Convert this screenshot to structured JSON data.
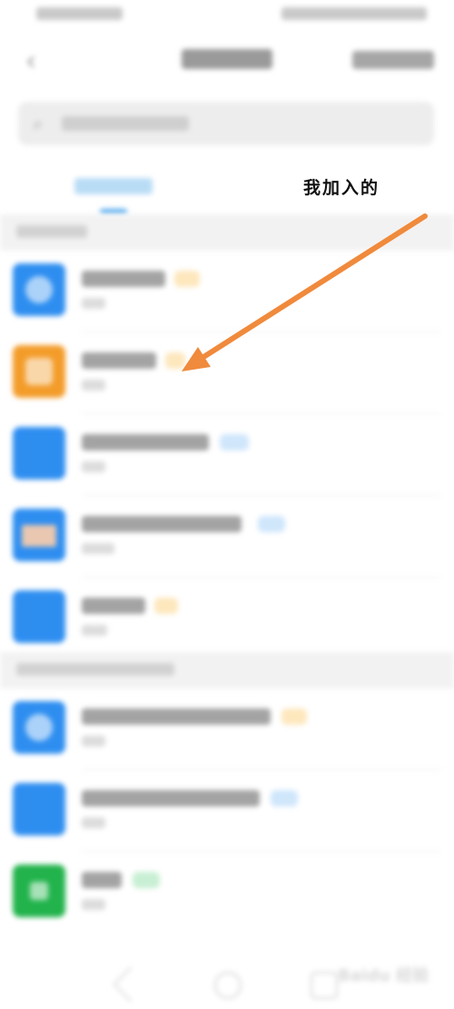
{
  "tabs": {
    "joined": "我加入的"
  },
  "watermark": "Baidu 经验",
  "arrow_color": "#f08a3c",
  "avatar_colors": [
    "#2e8ef0",
    "#f39c2a",
    "#2e8ef0",
    "#2e8ef0",
    "#2e8ef0",
    "#2e8ef0",
    "#2e8ef0",
    "#22b34c"
  ]
}
